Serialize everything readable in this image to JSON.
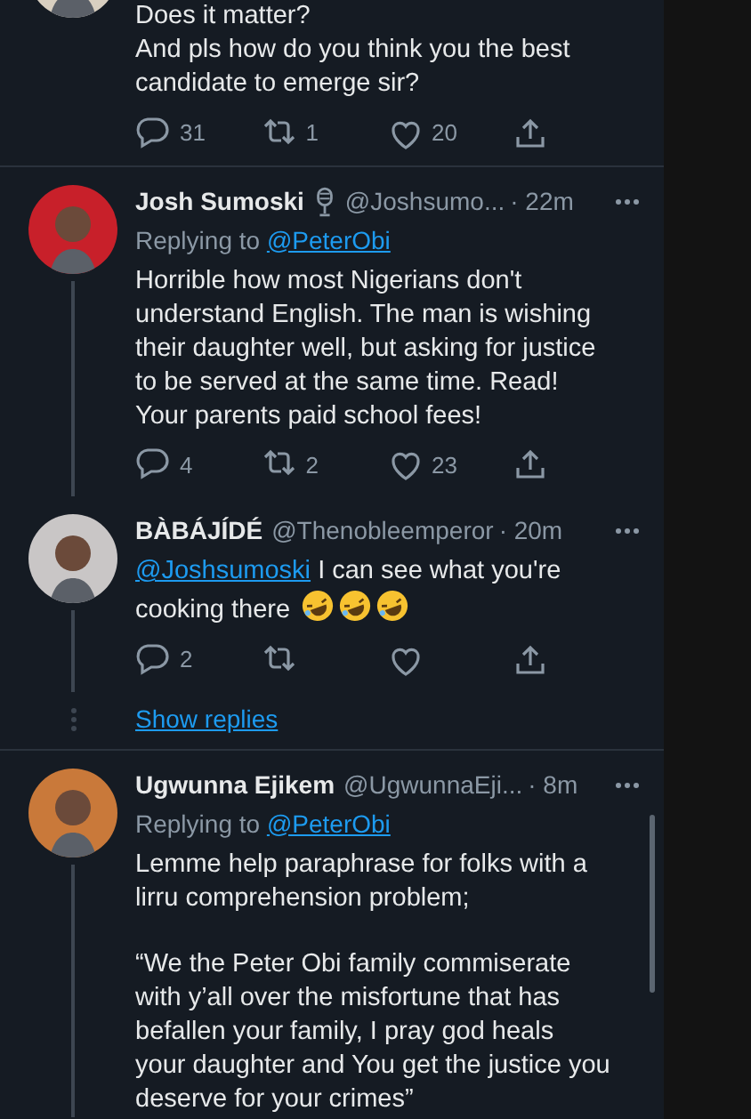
{
  "tweets": [
    {
      "partial": true,
      "color": "#d8cfc0",
      "lines": [
        "Does it matter?",
        "And pls how do you think you the best candidate to emerge sir?"
      ],
      "actions": {
        "replies": "31",
        "retweets": "1",
        "likes": "20"
      },
      "thread_line": false
    },
    {
      "partial": false,
      "color": "#c8202a",
      "name": "Josh Sumoski",
      "badge": true,
      "handle": "@Joshsumo...",
      "time": "· 22m",
      "replying_label": "Replying to",
      "replying_to": "@PeterObi",
      "lines": [
        "Horrible how most Nigerians don't understand English. The man is wishing their daughter well, but asking for justice to be served at the same time. Read! Your parents paid school fees!"
      ],
      "actions": {
        "replies": "4",
        "retweets": "2",
        "likes": "23"
      },
      "thread_line": true
    },
    {
      "partial": false,
      "color": "#c9c6c6",
      "name": "BÀBÁJÍDÉ",
      "handle": "@Thenobleemperor",
      "time": "· 20m",
      "mention": "@Joshsumoski",
      "lines": [
        "I can see what you're cooking there"
      ],
      "emojis": [
        {
          "kind": "rolling-laughing"
        },
        {
          "kind": "rolling-laughing"
        },
        {
          "kind": "rolling-laughing"
        }
      ],
      "actions": {
        "replies": "2"
      },
      "thread_line": true,
      "show_replies": "Show replies"
    },
    {
      "partial": false,
      "color": "#c9793a",
      "name": "Ugwunna Ejikem",
      "handle": "@UgwunnaEji...",
      "time": "· 8m",
      "replying_label": "Replying to",
      "replying_to": "@PeterObi",
      "lines": [
        "Lemme help paraphrase for folks with a lirru comprehension problem;",
        "“We the Peter Obi family commiserate with y’all over the misfortune that has befallen your family, I pray god heals your daughter and You get the justice you deserve for your crimes”"
      ],
      "thread_line": true
    }
  ]
}
